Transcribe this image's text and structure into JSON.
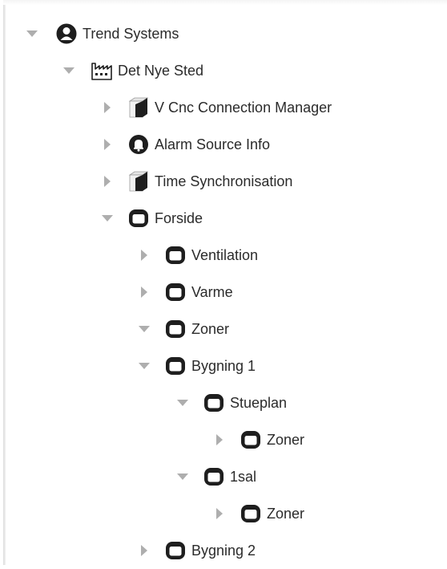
{
  "tree": {
    "root": {
      "label": "Trend Systems",
      "icon": "person-icon",
      "expanded": true
    },
    "station": {
      "label": "Det Nye Sted",
      "icon": "factory-icon",
      "expanded": true
    },
    "vcnc": {
      "label": "V Cnc Connection Manager",
      "icon": "cube-icon",
      "expanded": false
    },
    "alarm": {
      "label": "Alarm Source Info",
      "icon": "bell-icon",
      "expanded": false
    },
    "timesync": {
      "label": "Time Synchronisation",
      "icon": "cube-icon",
      "expanded": false
    },
    "forside": {
      "label": "Forside",
      "icon": "folder-icon",
      "expanded": true
    },
    "ventilation": {
      "label": "Ventilation",
      "icon": "folder-icon",
      "expanded": false
    },
    "varme": {
      "label": "Varme",
      "icon": "folder-icon",
      "expanded": false
    },
    "zoner": {
      "label": "Zoner",
      "icon": "folder-icon",
      "expanded": true
    },
    "bygning1": {
      "label": "Bygning 1",
      "icon": "folder-icon",
      "expanded": true
    },
    "stueplan": {
      "label": "Stueplan",
      "icon": "folder-icon",
      "expanded": true
    },
    "stueplan_zoner": {
      "label": "Zoner",
      "icon": "folder-icon",
      "expanded": false
    },
    "sal1": {
      "label": "1sal",
      "icon": "folder-icon",
      "expanded": true
    },
    "sal1_zoner": {
      "label": "Zoner",
      "icon": "folder-icon",
      "expanded": false
    },
    "bygning2": {
      "label": "Bygning 2",
      "icon": "folder-icon",
      "expanded": false
    }
  },
  "colors": {
    "toggle": "#aeaeae",
    "icon": "#1e1e1e",
    "text": "#2b2b2b"
  }
}
